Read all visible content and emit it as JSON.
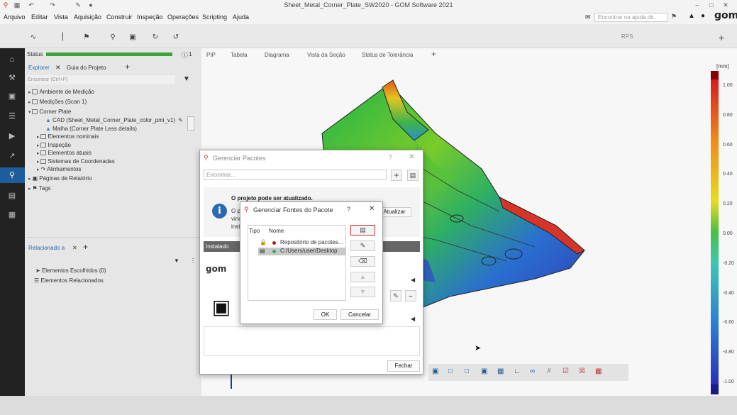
{
  "app": {
    "window_title": "Sheet_Metal_Corner_Plate_SW2020 - GOM Software 2021",
    "help_placeholder": "Encontrar na ajuda dir...",
    "logo": "gom"
  },
  "menu": [
    "Arquivo",
    "Editar",
    "Vista",
    "Aquisição",
    "Construir",
    "Inspeção",
    "Operações",
    "Scripting",
    "Ajuda"
  ],
  "toolbar": {
    "rps_label": "RPS"
  },
  "panel": {
    "status_label": "Status",
    "status_count": "1",
    "tabs": [
      "Explorer",
      "Guia do Projeto"
    ],
    "search_placeholder": "Encontrar (Ctrl+F)",
    "tree": [
      "Ambiente de Medição",
      "Medições (Scan 1)",
      "Corner Plate",
      "CAD (Sheet_Metal_Corner_Plate_color_pmi_v1)",
      "Malha (Corner Plate Less details)",
      "Elementos nominais",
      "Inspeção",
      "Elementos atuais",
      "Sistemas de Coordenadas",
      "Alinhamentos",
      "Páginas de Relatório",
      "Tags"
    ],
    "related_title": "Relacionado a",
    "related_items": [
      "Elementos Escolhidos (0)",
      "Elementos Relacionados"
    ]
  },
  "viewport": {
    "tabs": [
      "PIP",
      "Tabela",
      "Diagrama",
      "Vista da Seção",
      "Status de Tolerância"
    ]
  },
  "scale": {
    "unit": "[mm]",
    "ticks": [
      "1.00",
      "0.80",
      "0.60",
      "0.40",
      "0.20",
      "0.00",
      "-0.20",
      "-0.40",
      "-0.60",
      "-0.80",
      "-1.00"
    ]
  },
  "pkg_dialog": {
    "title": "Gerenciar Pacotes",
    "help": "?",
    "search_placeholder": "Encontrar...",
    "info_title": "O projeto pode ser atualizado.",
    "info_lines": [
      "O p",
      "vinc",
      "inst"
    ],
    "update_button": "Atualizar",
    "installed_label": "Instalado",
    "close_button": "Fechar"
  },
  "src_dialog": {
    "title": "Gerenciar Fontes do Pacote",
    "help": "?",
    "col_type": "Tipo",
    "col_name": "Nome",
    "rows": [
      {
        "name": "Repositório de pacotes...",
        "color": "#b32020"
      },
      {
        "name": "C:/Users/user/Desktop",
        "color": "#3cb043"
      }
    ],
    "ok_button": "OK",
    "cancel_button": "Cancelar"
  },
  "colors": {
    "accent": "#3c7fc4",
    "scale_max": "#8b0000",
    "scale_min": "#1a1a8f"
  }
}
